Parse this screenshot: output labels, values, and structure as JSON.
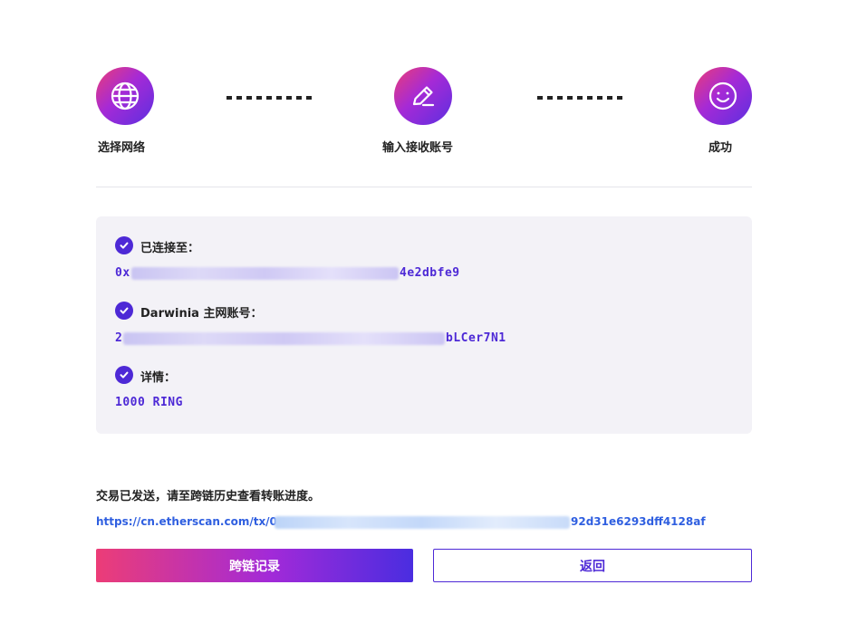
{
  "steps": [
    {
      "label": "选择网络",
      "icon": "globe-icon"
    },
    {
      "label": "输入接收账号",
      "icon": "pencil-icon"
    },
    {
      "label": "成功",
      "icon": "smile-icon"
    }
  ],
  "details": {
    "connected_label": "已连接至：",
    "connected_prefix": "0x",
    "connected_suffix": "4e2dbfe9",
    "account_label": "Darwinia 主网账号：",
    "account_prefix": "2",
    "account_suffix": "bLCer7N1",
    "detail_label": "详情：",
    "detail_value": "1000 RING"
  },
  "notice": "交易已发送，请至跨链历史查看转账进度。",
  "tx_link": {
    "prefix": "https://cn.etherscan.com/tx/0x",
    "suffix": "92d31e6293dff4128af"
  },
  "buttons": {
    "primary": "跨链记录",
    "secondary": "返回"
  },
  "colors": {
    "accent": "#4d29d6",
    "gradient_start": "#ec3d77",
    "gradient_end": "#4a2de0",
    "link": "#2f5fe0"
  }
}
